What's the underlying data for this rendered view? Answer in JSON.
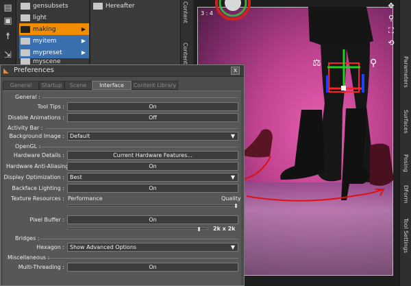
{
  "content_library": {
    "folders": [
      {
        "label": "gensubsets",
        "state": "normal"
      },
      {
        "label": "light",
        "state": "normal"
      },
      {
        "label": "making",
        "state": "selected"
      },
      {
        "label": "myitem",
        "state": "blue"
      },
      {
        "label": "mypreset",
        "state": "blue"
      },
      {
        "label": "myscene",
        "state": "normal"
      }
    ],
    "sub_folder": "Hereafter",
    "side_tabs": [
      "Content",
      "Content"
    ]
  },
  "viewport": {
    "aspect_ratio": "3 : 4",
    "right_tabs": [
      "Parameters",
      "Surfaces",
      "Posing",
      "DForm",
      "Tool Settings"
    ]
  },
  "preferences": {
    "title": "Preferences",
    "close_label": "x",
    "tabs": [
      "General",
      "Startup",
      "Scene",
      "Interface",
      "Content Library"
    ],
    "active_tab": "Interface",
    "sections": {
      "general": "General :",
      "activity_bar": "Activity Bar :",
      "opengl": "OpenGL :",
      "bridges": "Bridges :",
      "misc": "Miscellaneous :"
    },
    "tool_tips": {
      "label": "Tool Tips :",
      "value": "On"
    },
    "disable_animations": {
      "label": "Disable Animations :",
      "value": "Off"
    },
    "background_image": {
      "label": "Background Image :",
      "value": "Default"
    },
    "hardware_details": {
      "label": "Hardware Details :",
      "value": "Current Hardware Features..."
    },
    "hardware_aa": {
      "label": "Hardware Anti-Aliasing :",
      "value": "On"
    },
    "display_optimization": {
      "label": "Display Optimization :",
      "value": "Best"
    },
    "backface_lighting": {
      "label": "Backface Lighting :",
      "value": "On"
    },
    "texture_resources": {
      "label": "Texture Resources :",
      "low": "Performance",
      "high": "Quality",
      "level": 1.0
    },
    "pixel_buffer": {
      "label": "Pixel Buffer :",
      "value": "On",
      "size": "2k x 2k",
      "level": 0.95
    },
    "hexagon": {
      "label": "Hexagon :",
      "value": "Show Advanced Options"
    },
    "multi_threading": {
      "label": "Multi-Threading :",
      "value": "On"
    }
  },
  "colors": {
    "accent": "#f28c00",
    "selection_blue": "#3a6fb0",
    "annotation_red": "#e01010",
    "gizmo_red": "#ff2020",
    "gizmo_green": "#20d020",
    "gizmo_blue": "#2040ff"
  }
}
